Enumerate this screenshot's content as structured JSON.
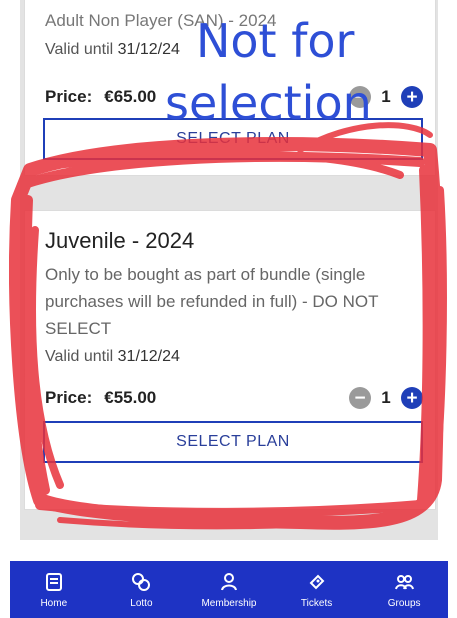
{
  "plans": [
    {
      "title": "Adult Non Player (SAN) - 2024",
      "valid_label": "Valid until",
      "valid_date": "31/12/24",
      "price_label": "Price:",
      "price_value": "€65.00",
      "quantity": "1",
      "button_label": "SELECT PLAN"
    },
    {
      "title": "Juvenile - 2024",
      "description": "Only to be bought as part of bundle (single purchases will be refunded in full) - DO NOT SELECT",
      "valid_label": "Valid until",
      "valid_date": "31/12/24",
      "price_label": "Price:",
      "price_value": "€55.00",
      "quantity": "1",
      "button_label": "SELECT PLAN"
    }
  ],
  "annotation": {
    "line1": "Not for",
    "line2": "selection",
    "text_color": "#2e4fd6",
    "scribble_color": "#e8323c"
  },
  "tabbar": {
    "background": "#1e33c4",
    "items": [
      {
        "label": "Home",
        "icon": "home-icon"
      },
      {
        "label": "Lotto",
        "icon": "lotto-icon"
      },
      {
        "label": "Membership",
        "icon": "membership-icon"
      },
      {
        "label": "Tickets",
        "icon": "ticket-icon"
      },
      {
        "label": "Groups",
        "icon": "groups-icon"
      }
    ]
  }
}
